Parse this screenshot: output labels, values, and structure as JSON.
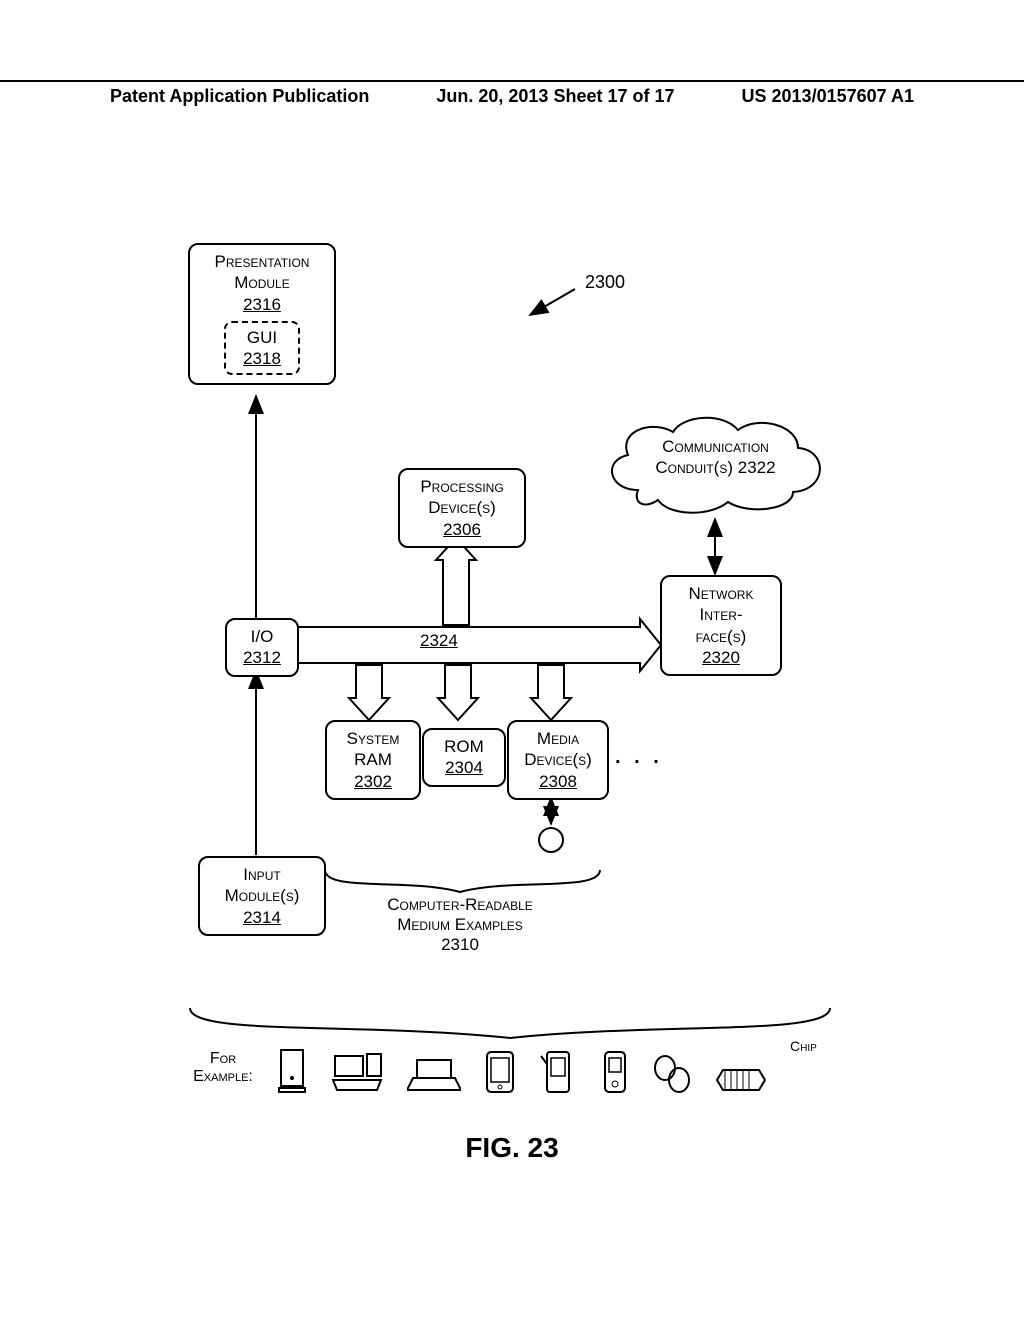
{
  "header": {
    "left": "Patent Application Publication",
    "center": "Jun. 20, 2013  Sheet 17 of 17",
    "right": "US 2013/0157607 A1"
  },
  "blocks": {
    "presentation": {
      "line1": "Presentation",
      "line2": "Module",
      "num": "2316"
    },
    "gui": {
      "label": "GUI",
      "num": "2318"
    },
    "processing": {
      "line1": "Processing",
      "line2": "Device(s)",
      "num": "2306"
    },
    "comm": {
      "line1": "Communication",
      "line2": "Conduit(s)",
      "num": "2322"
    },
    "io": {
      "label": "I/O",
      "num": "2312"
    },
    "bus": {
      "num": "2324"
    },
    "net": {
      "line1": "Network",
      "line2": "Inter-",
      "line3": "face(s)",
      "num": "2320"
    },
    "ram": {
      "line1": "System",
      "line2": "RAM",
      "num": "2302"
    },
    "rom": {
      "line1": "ROM",
      "num": "2304"
    },
    "media": {
      "line1": "Media",
      "line2": "Device(s)",
      "num": "2308"
    },
    "dots": ". . .",
    "input": {
      "line1": "Input",
      "line2": "Module(s)",
      "num": "2314"
    },
    "medium_label": {
      "line1": "Computer-Readable",
      "line2": "Medium Examples",
      "num": "2310"
    },
    "ref_2300": "2300",
    "for_example": "For\nExample:",
    "chip": "Chip"
  },
  "figure_caption": "FIG. 23"
}
